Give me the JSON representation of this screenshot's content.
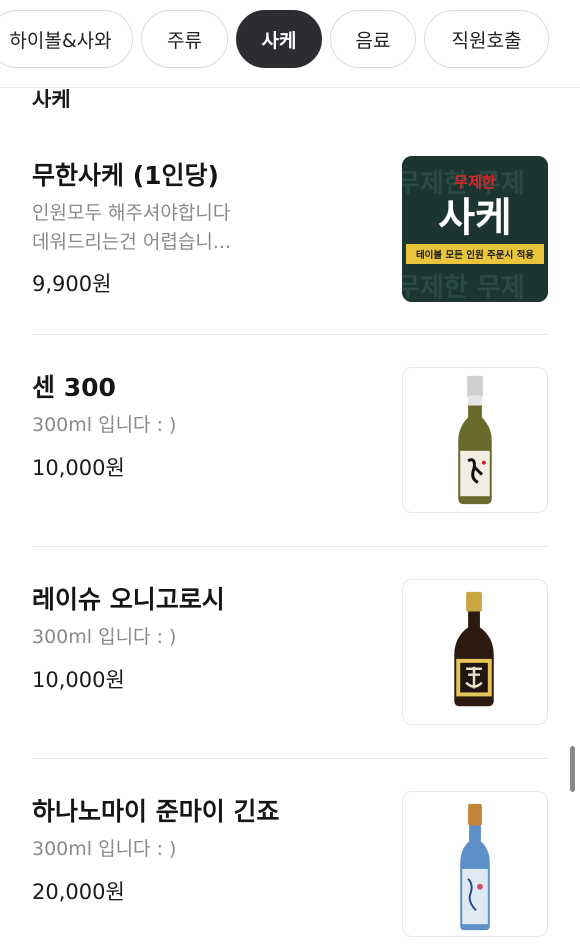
{
  "tabs": [
    {
      "label": "하이볼&사와",
      "active": false
    },
    {
      "label": "주류",
      "active": false
    },
    {
      "label": "사케",
      "active": true
    },
    {
      "label": "음료",
      "active": false
    },
    {
      "label": "직원호출",
      "active": false
    }
  ],
  "category_title": "사케",
  "items": [
    {
      "name": "무한사케 (1인당)",
      "desc_line1": "인원모두 해주셔야합니다",
      "desc_line2": "데워드리는건 어렵습니...",
      "price": "9,900원",
      "thumb": {
        "top_text": "무제한",
        "big_text": "사케",
        "banner_text": "테이블 모든 인원 주문시 적용",
        "bg_text": "무제한 무제"
      }
    },
    {
      "name": "센 300",
      "desc_line1": "300ml 입니다 : )",
      "price": "10,000원"
    },
    {
      "name": "레이슈 오니고로시",
      "desc_line1": "300ml 입니다 : )",
      "price": "10,000원"
    },
    {
      "name": "하나노마이 준마이 긴죠",
      "desc_line1": "300ml 입니다 : )",
      "price": "20,000원"
    }
  ],
  "colors": {
    "accent_dark": "#2b2d31",
    "sake_card_bg": "#1c3530",
    "sake_red": "#d8262c",
    "banner_yellow": "#e8c53a"
  }
}
